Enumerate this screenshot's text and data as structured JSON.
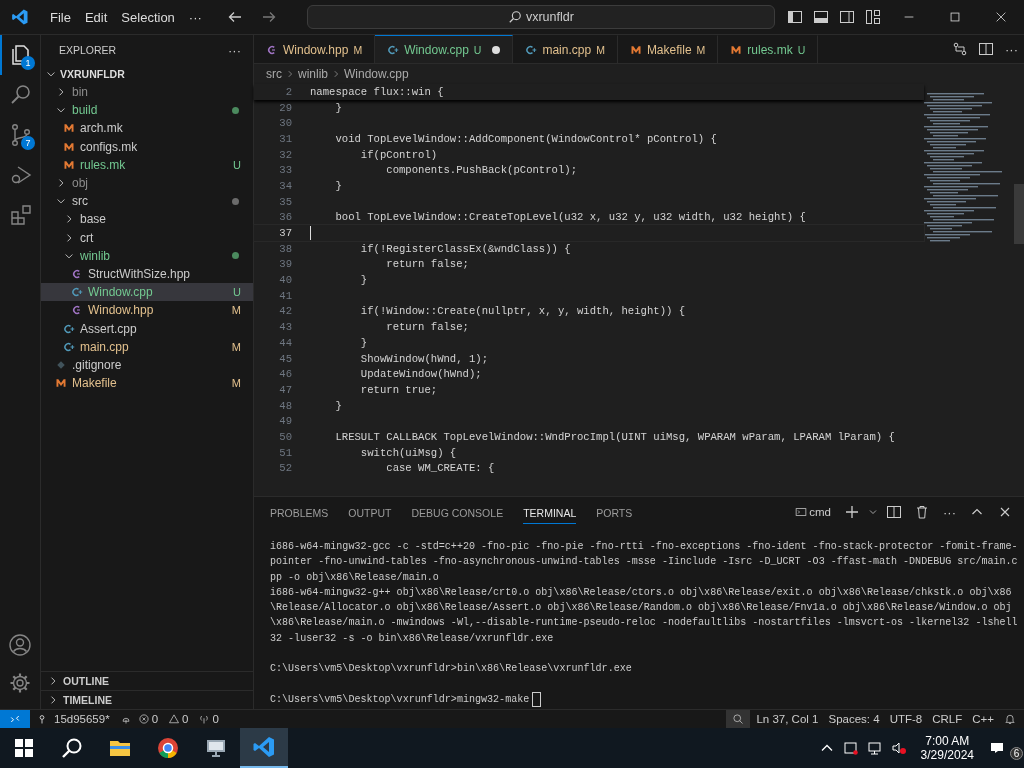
{
  "menu": [
    "File",
    "Edit",
    "Selection",
    "···"
  ],
  "search": {
    "value": "vxrunfldr"
  },
  "activity": [
    {
      "kind": "files",
      "badge": "1",
      "selected": true
    },
    {
      "kind": "search",
      "selected": false
    },
    {
      "kind": "scm",
      "badge": "7",
      "selected": false
    },
    {
      "kind": "debug",
      "selected": false
    },
    {
      "kind": "extensions",
      "selected": false
    }
  ],
  "explorer": {
    "title": "EXPLORER",
    "more": "···",
    "root": "VXRUNFLDR",
    "root_expanded": true,
    "items": [
      {
        "name": "bin",
        "kind": "folder",
        "expanded": false,
        "color": "#8c8c8c",
        "selected": false
      },
      {
        "name": "build",
        "kind": "folder",
        "expanded": true,
        "color": "#73c991",
        "dot": {
          "color": "#4b8a5e"
        },
        "selected": false,
        "children": [
          {
            "name": "arch.mk",
            "kind": "make",
            "color": "#cccccc",
            "selected": false
          },
          {
            "name": "configs.mk",
            "kind": "make",
            "color": "#cccccc",
            "selected": false
          },
          {
            "name": "rules.mk",
            "kind": "make",
            "color": "#73c991",
            "badge": "U",
            "selected": false
          }
        ]
      },
      {
        "name": "obj",
        "kind": "folder",
        "expanded": false,
        "color": "#8c8c8c",
        "selected": false
      },
      {
        "name": "src",
        "kind": "folder",
        "expanded": true,
        "color": "#cccccc",
        "dot": {
          "color": "#6b6b6b"
        },
        "selected": false,
        "children": [
          {
            "name": "base",
            "kind": "folder",
            "expanded": false,
            "color": "#cccccc",
            "selected": false
          },
          {
            "name": "crt",
            "kind": "folder",
            "expanded": false,
            "color": "#cccccc",
            "selected": false
          },
          {
            "name": "winlib",
            "kind": "folder",
            "expanded": true,
            "color": "#73c991",
            "dot": {
              "color": "#4b8a5e"
            },
            "selected": false,
            "children": [
              {
                "name": "StructWithSize.hpp",
                "kind": "hpp",
                "color": "#cccccc",
                "selected": false
              },
              {
                "name": "Window.cpp",
                "kind": "cpp",
                "color": "#73c991",
                "badge": "U",
                "selected": true
              },
              {
                "name": "Window.hpp",
                "kind": "hpp",
                "color": "#e2c08d",
                "badge": "M",
                "selected": false
              }
            ]
          },
          {
            "name": "Assert.cpp",
            "kind": "cpp",
            "color": "#cccccc",
            "selected": false
          },
          {
            "name": "main.cpp",
            "kind": "cpp",
            "color": "#e2c08d",
            "badge": "M",
            "selected": false
          }
        ]
      },
      {
        "name": ".gitignore",
        "kind": "gitignore",
        "color": "#cccccc",
        "selected": false
      },
      {
        "name": "Makefile",
        "kind": "make",
        "color": "#e2c08d",
        "badge": "M",
        "selected": false
      }
    ],
    "sections": [
      {
        "label": "OUTLINE",
        "expanded": false
      },
      {
        "label": "TIMELINE",
        "expanded": false
      }
    ]
  },
  "tabs": [
    {
      "label": "Window.hpp",
      "kind": "hpp",
      "badge": "M",
      "color": "#e2c08d",
      "selected": false,
      "dirty": false
    },
    {
      "label": "Window.cpp",
      "kind": "cpp",
      "badge": "U",
      "color": "#73c991",
      "selected": true,
      "dirty": true
    },
    {
      "label": "main.cpp",
      "kind": "cpp",
      "badge": "M",
      "color": "#e2c08d",
      "selected": false,
      "dirty": false
    },
    {
      "label": "Makefile",
      "kind": "make",
      "badge": "M",
      "color": "#e2c08d",
      "selected": false,
      "dirty": false
    },
    {
      "label": "rules.mk",
      "kind": "make",
      "badge": "U",
      "color": "#73c991",
      "selected": false,
      "dirty": false
    }
  ],
  "breadcrumb": [
    "src",
    "winlib",
    "Window.cpp"
  ],
  "sticky": {
    "num": "2",
    "text": "namespace flux::win {"
  },
  "code": [
    {
      "num": "29",
      "text": "    }",
      "current": false
    },
    {
      "num": "30",
      "current": false
    },
    {
      "num": "31",
      "text": "    void TopLevelWindow::AddComponent(WindowControl* pControl) {",
      "current": false
    },
    {
      "num": "32",
      "text": "        if(pControl)",
      "current": false
    },
    {
      "num": "33",
      "text": "            components.PushBack(pControl);",
      "current": false
    },
    {
      "num": "34",
      "text": "    }",
      "current": false
    },
    {
      "num": "35",
      "current": false
    },
    {
      "num": "36",
      "text": "    bool TopLevelWindow::CreateTopLevel(u32 x, u32 y, u32 width, u32 height) {",
      "current": false
    },
    {
      "num": "37",
      "current": true
    },
    {
      "num": "38",
      "text": "        if(!RegisterClassEx(&wndClass)) {",
      "current": false
    },
    {
      "num": "39",
      "text": "            return false;",
      "current": false
    },
    {
      "num": "40",
      "text": "        }",
      "current": false
    },
    {
      "num": "41",
      "current": false
    },
    {
      "num": "42",
      "text": "        if(!Window::Create(nullptr, x, y, width, height)) {",
      "current": false
    },
    {
      "num": "43",
      "text": "            return false;",
      "current": false
    },
    {
      "num": "44",
      "text": "        }",
      "current": false
    },
    {
      "num": "45",
      "text": "        ShowWindow(hWnd, 1);",
      "current": false
    },
    {
      "num": "46",
      "text": "        UpdateWindow(hWnd);",
      "current": false
    },
    {
      "num": "47",
      "text": "        return true;",
      "current": false
    },
    {
      "num": "48",
      "text": "    }",
      "current": false
    },
    {
      "num": "49",
      "current": false
    },
    {
      "num": "50",
      "text": "    LRESULT CALLBACK TopLevelWindow::WndProcImpl(UINT uiMsg, WPARAM wParam, LPARAM lParam) {",
      "current": false
    },
    {
      "num": "51",
      "text": "        switch(uiMsg) {",
      "current": false
    },
    {
      "num": "52",
      "text": "            case WM_CREATE: {",
      "current": false
    }
  ],
  "panel_tabs": [
    {
      "label": "PROBLEMS",
      "selected": false
    },
    {
      "label": "OUTPUT",
      "selected": false
    },
    {
      "label": "DEBUG CONSOLE",
      "selected": false
    },
    {
      "label": "TERMINAL",
      "selected": true
    },
    {
      "label": "PORTS",
      "selected": false
    }
  ],
  "terminal": {
    "shell": "cmd",
    "more": "···",
    "lines": [
      {
        "kind": "output",
        "text": "i686-w64-mingw32-gcc -c -std=c++20 -fno-pic -fno-pie -fno-rtti -fno-exceptions -fno-ident -fno-stack-protector -fomit-frame-pointer -fno-unwind-tables -fno-asynchronous-unwind-tables -msse -Iinclude -Isrc -D_UCRT -O3 -ffast-math -DNDEBUG src/main.cpp -o obj\\x86\\Release/main.o"
      },
      {
        "kind": "output",
        "text": "i686-w64-mingw32-g++ obj\\x86\\Release/crt0.o obj\\x86\\Release/ctors.o obj\\x86\\Release/exit.o obj\\x86\\Release/chkstk.o obj\\x86\\Release/Allocator.o obj\\x86\\Release/Assert.o obj\\x86\\Release/Random.o obj\\x86\\Release/Fnv1a.o obj\\x86\\Release/Window.o obj\\x86\\Release/main.o -mwindows -Wl,--disable-runtime-pseudo-reloc -nodefaultlibs -nostartfiles -lmsvcrt-os -lkernel32 -lshell32 -luser32 -s -o bin\\x86\\Release/vxrunfldr.exe"
      },
      {
        "kind": "prompt",
        "text": "C:\\Users\\vm5\\Desktop\\vxrunfldr>bin\\x86\\Release\\vxrunfldr.exe",
        "cursor": false
      },
      {
        "kind": "prompt",
        "text": "C:\\Users\\vm5\\Desktop\\vxrunfldr>mingw32-make",
        "cursor": true
      }
    ]
  },
  "status": {
    "branch": "15d95659*",
    "errors": "0",
    "warnings": "0",
    "ports": "0",
    "right": [
      "Ln 37, Col 1",
      "Spaces: 4",
      "UTF-8",
      "CRLF",
      "C++"
    ]
  },
  "taskbar": {
    "apps": [
      {
        "kind": "start",
        "active": false
      },
      {
        "kind": "search",
        "active": false
      },
      {
        "kind": "folder",
        "active": false
      },
      {
        "kind": "browser",
        "active": false
      },
      {
        "kind": "monitor",
        "active": false
      },
      {
        "kind": "code",
        "active": true
      }
    ],
    "time": "7:00 AM",
    "date": "3/29/2024",
    "notifications": "6"
  }
}
